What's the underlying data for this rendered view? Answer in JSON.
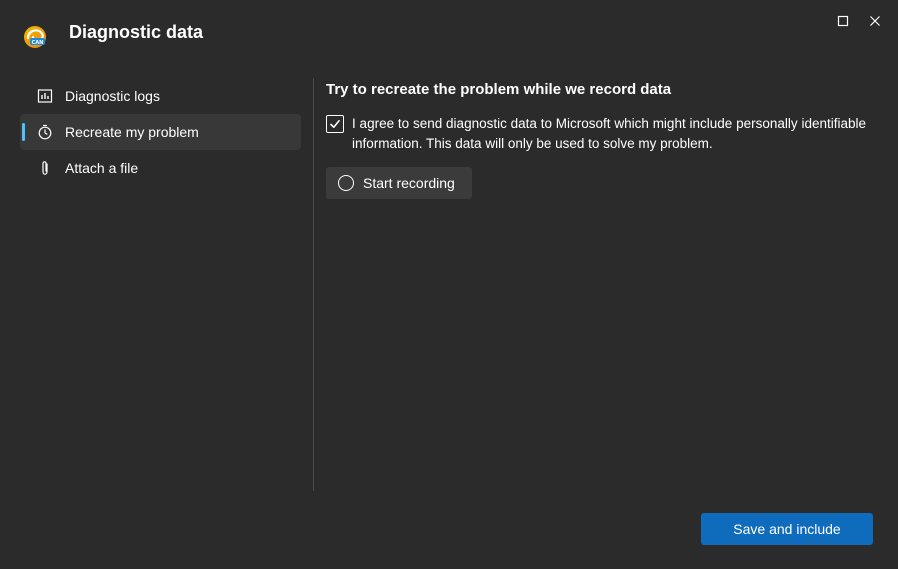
{
  "window": {
    "title": "Diagnostic data",
    "logo_icon": "edge-canary-logo",
    "controls": [
      "maximize-icon",
      "close-icon"
    ]
  },
  "sidebar": {
    "items": [
      {
        "label": "Diagnostic logs",
        "icon": "bar-chart-icon",
        "active": false
      },
      {
        "label": "Recreate my problem",
        "icon": "stopwatch-icon",
        "active": true
      },
      {
        "label": "Attach a file",
        "icon": "paperclip-icon",
        "active": false
      }
    ]
  },
  "main": {
    "heading": "Try to recreate the problem while we record data",
    "consent": {
      "checked": true,
      "text": "I agree to send diagnostic data to Microsoft which might include personally identifiable information. This data will only be used to solve my problem."
    },
    "record_button": {
      "label": "Start recording",
      "icon": "radio-circle-icon"
    }
  },
  "footer": {
    "primary_button": "Save and include"
  },
  "colors": {
    "background": "#2b2b2b",
    "accent": "#0f6cbd",
    "indicator": "#4cc2ff"
  }
}
